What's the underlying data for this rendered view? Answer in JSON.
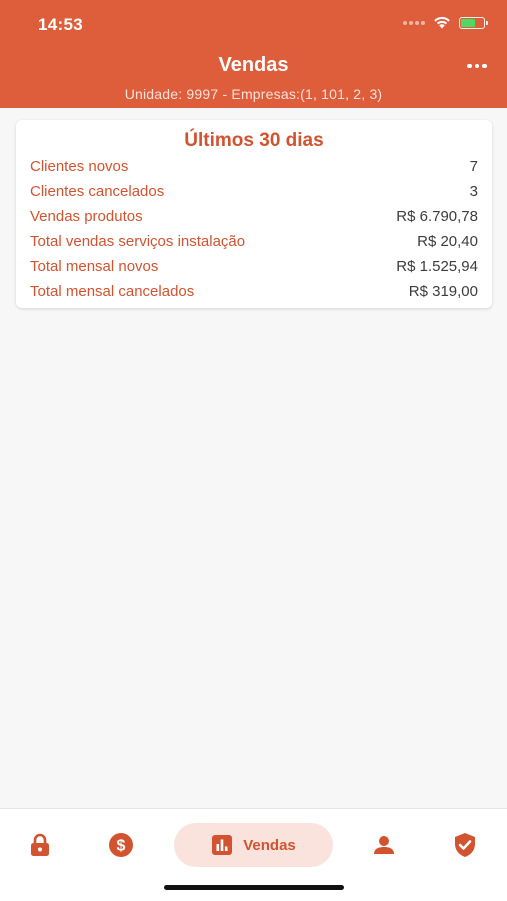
{
  "status_bar": {
    "time": "14:53"
  },
  "header": {
    "title": "Vendas",
    "subtitle": "Unidade: 9997 - Empresas:(1, 101, 2, 3)"
  },
  "summary_card": {
    "title": "Últimos 30 dias",
    "rows": [
      {
        "label": "Clientes novos",
        "value": "7"
      },
      {
        "label": "Clientes cancelados",
        "value": "3"
      },
      {
        "label": "Vendas produtos",
        "value": "R$ 6.790,78"
      },
      {
        "label": "Total vendas serviços instalação",
        "value": "R$ 20,40"
      },
      {
        "label": "Total mensal novos",
        "value": "R$ 1.525,94"
      },
      {
        "label": "Total mensal cancelados",
        "value": "R$ 319,00"
      }
    ]
  },
  "bottom_nav": {
    "items": [
      {
        "icon": "lock-icon"
      },
      {
        "icon": "dollar-circle-icon"
      },
      {
        "icon": "bar-chart-icon",
        "label": "Vendas",
        "active": true
      },
      {
        "icon": "person-icon"
      },
      {
        "icon": "shield-check-icon"
      }
    ]
  },
  "colors": {
    "header_background": "#de5d3a",
    "accent": "#d2532f",
    "active_tab_background": "#f9e3dc",
    "page_background": "#f7f7f7"
  }
}
